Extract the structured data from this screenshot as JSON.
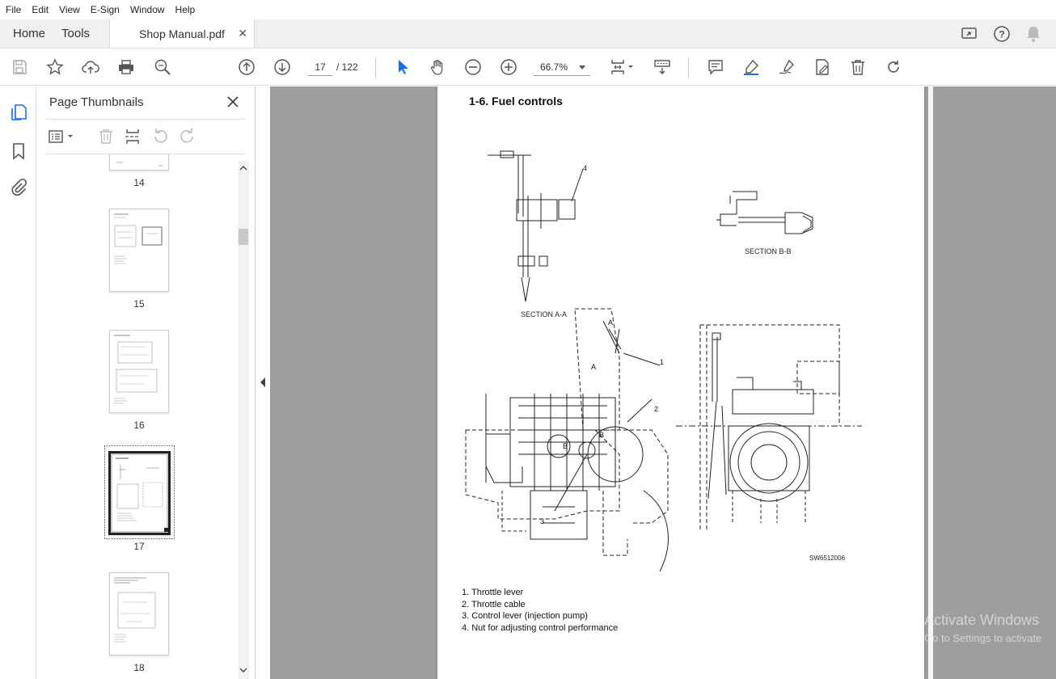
{
  "menu": [
    "File",
    "Edit",
    "View",
    "E-Sign",
    "Window",
    "Help"
  ],
  "tabs": {
    "home": "Home",
    "tools": "Tools",
    "document": "Shop Manual.pdf"
  },
  "toolbar": {
    "current_page": "17",
    "total_pages": "/ 122",
    "zoom": "66.7%"
  },
  "panel": {
    "title": "Page Thumbnails",
    "thumbnails": [
      {
        "label": "14"
      },
      {
        "label": "15"
      },
      {
        "label": "16"
      },
      {
        "label": "17",
        "selected": true
      },
      {
        "label": "18"
      }
    ]
  },
  "document": {
    "heading": "1-6. Fuel controls",
    "captions": {
      "section_aa": "SECTION A-A",
      "section_bb": "SECTION B-B",
      "figure_id": "SW6512006"
    },
    "callouts": [
      "1",
      "2",
      "3",
      "4"
    ],
    "markers": [
      "A",
      "A",
      "B",
      "B"
    ],
    "legend": [
      "1. Throttle lever",
      "2. Throttle cable",
      "3. Control lever (injection pump)",
      "4. Nut for adjusting control performance"
    ]
  },
  "watermark": {
    "line1": "Activate Windows",
    "line2": "Go to Settings to activate"
  },
  "colors": {
    "accent": "#1473e6",
    "doc_background": "#9e9e9e"
  }
}
